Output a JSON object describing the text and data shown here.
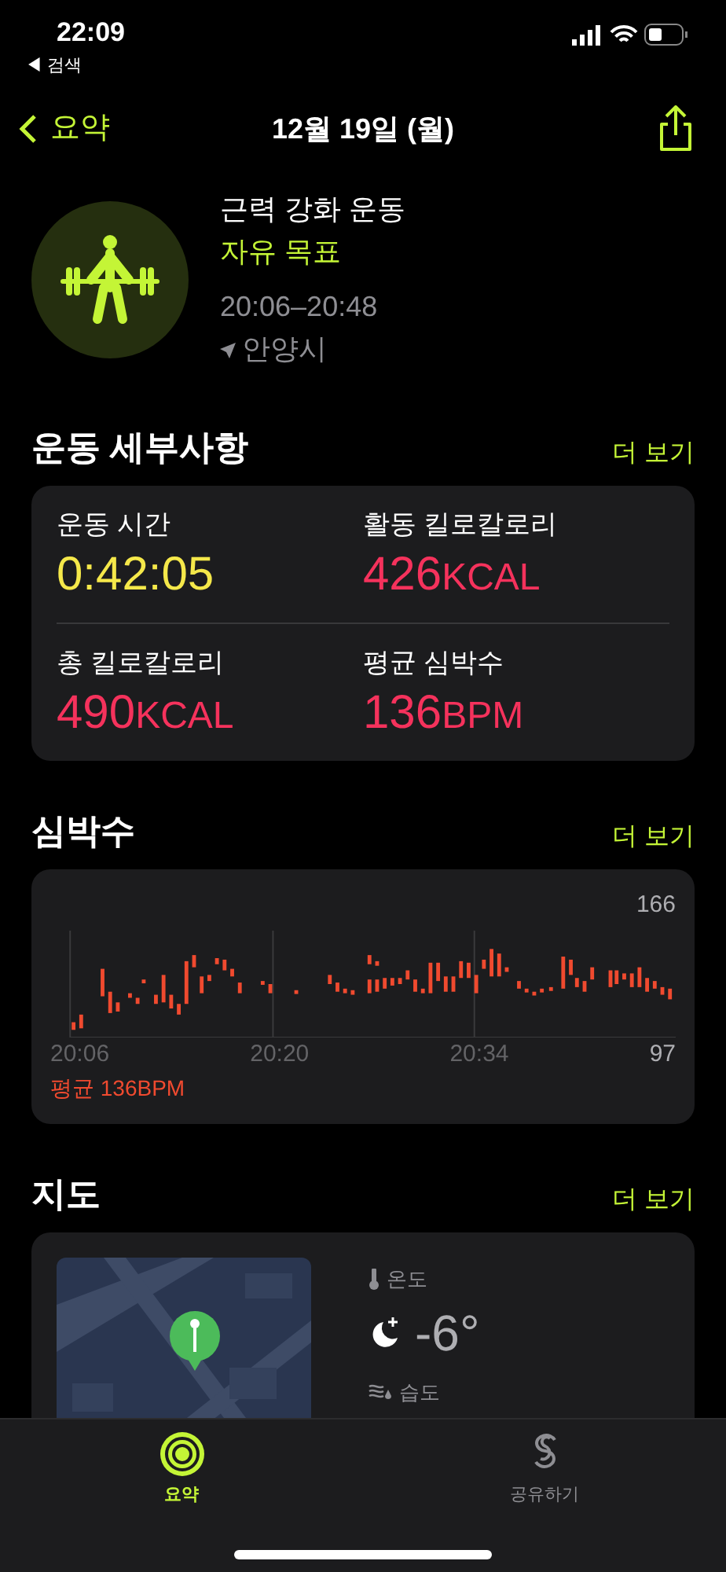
{
  "status_bar": {
    "time": "22:09",
    "back_label": "◀ 검색"
  },
  "nav": {
    "back": "요약",
    "title": "12월 19일 (월)"
  },
  "workout": {
    "name": "근력 강화 운동",
    "goal": "자유 목표",
    "time_range": "20:06–20:48",
    "location": "안양시"
  },
  "details": {
    "title": "운동 세부사항",
    "more": "더 보기",
    "metrics": [
      {
        "label": "운동 시간",
        "value": "0:42:05",
        "color": "#f5e84a"
      },
      {
        "label": "활동 킬로칼로리",
        "value": "426",
        "unit": "KCAL",
        "color": "#f5325c"
      },
      {
        "label": "총 킬로칼로리",
        "value": "490",
        "unit": "KCAL",
        "color": "#f5325c"
      },
      {
        "label": "평균 심박수",
        "value": "136",
        "unit": "BPM",
        "color": "#f5325c"
      }
    ]
  },
  "heart_rate": {
    "title": "심박수",
    "more": "더 보기",
    "max": "166",
    "min": "97",
    "times": [
      "20:06",
      "20:20",
      "20:34"
    ],
    "average": "평균 136BPM"
  },
  "map": {
    "title": "지도",
    "more": "더 보기",
    "temperature_label": "온도",
    "temperature": "-6°",
    "humidity_label": "습도"
  },
  "tab_bar": [
    {
      "label": "요약",
      "selected": true
    },
    {
      "label": "공유하기",
      "selected": false
    }
  ]
}
